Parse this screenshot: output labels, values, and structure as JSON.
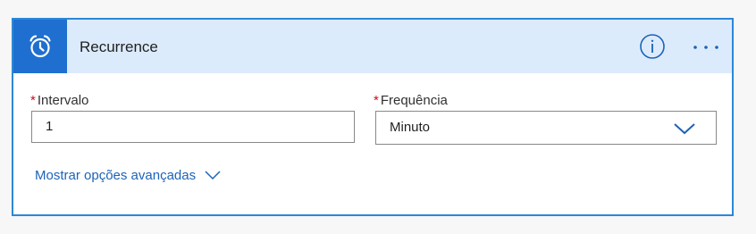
{
  "card": {
    "title": "Recurrence",
    "trigger_icon": "alarm-clock-icon",
    "info_icon": "info-icon",
    "more_icon": "more-options-icon",
    "accent_color": "#1f6fd0",
    "header_color": "#dcebfc"
  },
  "fields": {
    "interval": {
      "required_mark": "*",
      "label": "Intervalo",
      "value": "1"
    },
    "frequency": {
      "required_mark": "*",
      "label": "Frequência",
      "value": "Minuto",
      "dropdown_icon": "chevron-down-icon"
    }
  },
  "advanced": {
    "label": "Mostrar opções avançadas",
    "icon": "chevron-down-icon"
  }
}
